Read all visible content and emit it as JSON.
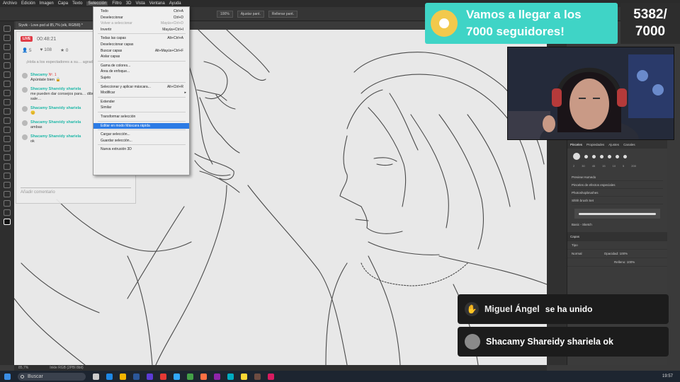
{
  "photoshop": {
    "menu_items": [
      "Archivo",
      "Edición",
      "Imagen",
      "Capa",
      "Texto",
      "Selección",
      "Filtro",
      "3D",
      "Vista",
      "Ventana",
      "Ayuda"
    ],
    "active_menu": "Selección",
    "options": {
      "zoom": "100%",
      "fit_screen": "Ajustar pant.",
      "fill_screen": "Rellenar pant."
    },
    "doc_tab": "Siyvik - Love.psd al 85,7% (elk, RGB/8) *",
    "status_zoom": "85,7%",
    "status_doc": "Inkle RGB (2PBl 8bit)"
  },
  "selection_menu": [
    {
      "label": "Todo",
      "shortcut": "Ctrl+A",
      "disabled": false
    },
    {
      "label": "Deseleccionar",
      "shortcut": "Ctrl+D",
      "disabled": false
    },
    {
      "label": "Volver a seleccionar",
      "shortcut": "Mayús+Ctrl+D",
      "disabled": true
    },
    {
      "label": "Invertir",
      "shortcut": "Mayús+Ctrl+I",
      "disabled": false
    },
    {
      "separator": true
    },
    {
      "label": "Todas las capas",
      "shortcut": "Alt+Ctrl+A",
      "disabled": false
    },
    {
      "label": "Deseleccionar capas",
      "shortcut": "",
      "disabled": false
    },
    {
      "label": "Buscar capas",
      "shortcut": "Alt+Mayús+Ctrl+F",
      "disabled": false
    },
    {
      "label": "Aislar capas",
      "shortcut": "",
      "disabled": false
    },
    {
      "separator": true
    },
    {
      "label": "Gama de colores...",
      "shortcut": "",
      "disabled": false
    },
    {
      "label": "Área de enfoque...",
      "shortcut": "",
      "disabled": false
    },
    {
      "label": "Sujeto",
      "shortcut": "",
      "disabled": false
    },
    {
      "separator": true
    },
    {
      "label": "Seleccionar y aplicar máscara...",
      "shortcut": "Alt+Ctrl+R",
      "disabled": false
    },
    {
      "label": "Modificar",
      "shortcut": "",
      "disabled": false,
      "submenu": true
    },
    {
      "separator": true
    },
    {
      "label": "Extender",
      "shortcut": "",
      "disabled": false
    },
    {
      "label": "Similar",
      "shortcut": "",
      "disabled": false
    },
    {
      "separator": true
    },
    {
      "label": "Transformar selección",
      "shortcut": "",
      "disabled": false
    },
    {
      "separator": true
    },
    {
      "label": "Editar en modo Máscara rápida",
      "shortcut": "",
      "disabled": false,
      "highlighted": true
    },
    {
      "separator": true
    },
    {
      "label": "Cargar selección...",
      "shortcut": "",
      "disabled": false
    },
    {
      "label": "Guardar selección...",
      "shortcut": "",
      "disabled": false
    },
    {
      "separator": true
    },
    {
      "label": "Nueva extrusión 3D",
      "shortcut": "",
      "disabled": false
    }
  ],
  "chat": {
    "live_badge": "LIVE",
    "timer": "00:48:21",
    "viewers": "5",
    "followers": "108",
    "likes": "0",
    "welcome": "¡Hola a los espectadores a su… agradecidos en su…",
    "messages": [
      {
        "user": "Shacamy",
        "badge": "Nº. 1",
        "text": "Apúntate bien 🔒"
      },
      {
        "user": "Shacamy Shareidy shariela",
        "text": "me pueden dar consejos para… dibujos porque a mí me sale…"
      },
      {
        "user": "Shacamy Shareidy shariela",
        "text": "😊"
      },
      {
        "user": "Shacamy Shareidy shariela",
        "text": "ambas"
      },
      {
        "user": "Shacamy Shareidy shariela",
        "text": "ok"
      }
    ],
    "input_placeholder": "Añadir comentario"
  },
  "goal": {
    "text": "Vamos a llegar a los 7000 seguidores!",
    "current": "5382/",
    "target": "7000",
    "color": "#3fd4c6"
  },
  "panels": {
    "brush_tabs": [
      "Pinceles",
      "Propiedades",
      "Ajustes",
      "Canales"
    ],
    "brush_sizes": [
      "2",
      "30",
      "45",
      "15",
      "10",
      "5",
      "200"
    ],
    "brush_groups": [
      "Preview Humedo",
      "Pinceles de efectos especiales",
      "Photoshopbrushes",
      "Shhh brush Set"
    ],
    "brush_name": "Basic - Sketch",
    "layers_title": "Capas",
    "layer_kind": "Tipo",
    "blend_mode": "Normal",
    "opacity_label": "Opacidad:",
    "opacity": "100%",
    "fill_label": "Relleno:",
    "fill": "100%",
    "layer_name": "Capa 1"
  },
  "notifications": [
    {
      "icon": "wave-icon",
      "name": "Miguel Ángel",
      "action": "se ha unido"
    },
    {
      "icon": "avatar",
      "name": "Shacamy Shareidy shariela ok",
      "action": ""
    }
  ],
  "taskbar": {
    "search": "Buscar",
    "time": "19:57"
  }
}
